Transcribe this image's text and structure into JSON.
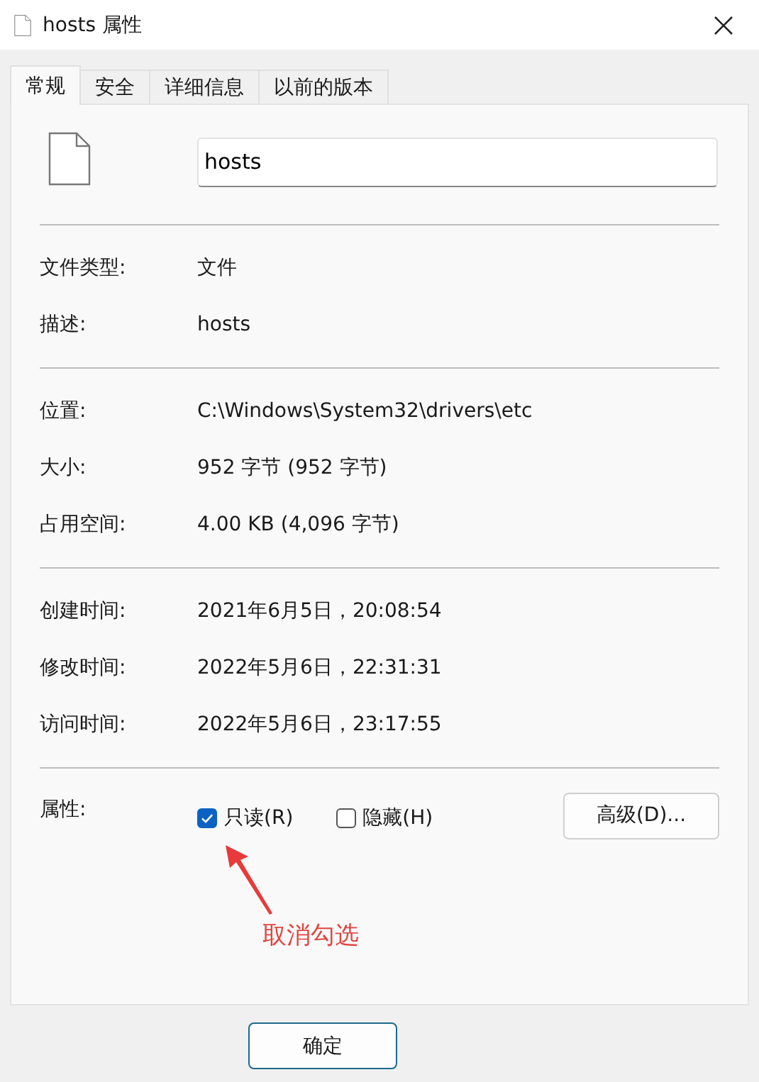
{
  "window": {
    "title": "hosts 属性"
  },
  "tabs": [
    {
      "label": "常规",
      "selected": true
    },
    {
      "label": "安全",
      "selected": false
    },
    {
      "label": "详细信息",
      "selected": false
    },
    {
      "label": "以前的版本",
      "selected": false
    }
  ],
  "file_name": "hosts",
  "sections": [
    [
      {
        "label": "文件类型:",
        "value": "文件"
      },
      {
        "label": "描述:",
        "value": "hosts"
      }
    ],
    [
      {
        "label": "位置:",
        "value": "C:\\Windows\\System32\\drivers\\etc"
      },
      {
        "label": "大小:",
        "value": "952 字节 (952 字节)"
      },
      {
        "label": "占用空间:",
        "value": "4.00 KB (4,096 字节)"
      }
    ],
    [
      {
        "label": "创建时间:",
        "value": "2021年6月5日，20:08:54"
      },
      {
        "label": "修改时间:",
        "value": "2022年5月6日，22:31:31"
      },
      {
        "label": "访问时间:",
        "value": "2022年5月6日，23:17:55"
      }
    ]
  ],
  "attributes": {
    "label": "属性:",
    "options": [
      {
        "label": "只读(R)",
        "checked": true
      },
      {
        "label": "隐藏(H)",
        "checked": false
      }
    ],
    "advanced_button": "高级(D)..."
  },
  "annotation": {
    "text": "取消勾选"
  },
  "buttons": [
    "确定"
  ]
}
